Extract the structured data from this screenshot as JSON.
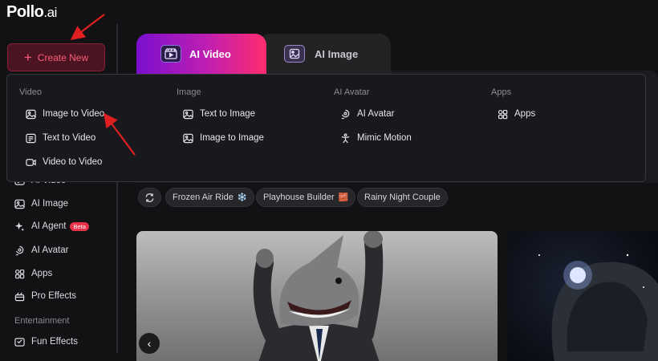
{
  "logo": {
    "brand": "Pollo",
    "suffix": ".ai"
  },
  "create_button": {
    "label": "Create New"
  },
  "sidebar": {
    "items": [
      {
        "label": "AI Video",
        "icon": "video-icon"
      },
      {
        "label": "AI Image",
        "icon": "image-icon"
      },
      {
        "label": "AI Agent",
        "icon": "sparkle-icon",
        "badge": "Beta"
      },
      {
        "label": "AI Avatar",
        "icon": "avatar-icon"
      },
      {
        "label": "Apps",
        "icon": "apps-icon"
      },
      {
        "label": "Pro Effects",
        "icon": "effects-icon"
      }
    ],
    "section_entertainment": "Entertainment",
    "entertainment_items": [
      {
        "label": "Fun Effects",
        "icon": "fun-effects-icon"
      }
    ]
  },
  "tabs": [
    {
      "label": "AI Video",
      "active": true
    },
    {
      "label": "AI Image",
      "active": false
    }
  ],
  "dropdown": {
    "columns": [
      {
        "heading": "Video",
        "items": [
          "Image to Video",
          "Text to Video",
          "Video to Video"
        ]
      },
      {
        "heading": "Image",
        "items": [
          "Text to Image",
          "Image to Image"
        ]
      },
      {
        "heading": "AI Avatar",
        "items": [
          "AI Avatar",
          "Mimic Motion"
        ]
      },
      {
        "heading": "Apps",
        "items": [
          "Apps"
        ]
      }
    ]
  },
  "chips": [
    {
      "label": "Frozen Air Ride",
      "emoji": "❄️"
    },
    {
      "label": "Playhouse Builder",
      "emoji": "🧱"
    },
    {
      "label": "Rainy Night Couple",
      "emoji": ""
    }
  ],
  "colors": {
    "accent": "#ff2d6f",
    "purple": "#7a0fcf",
    "create_bg": "#4a1422",
    "annotation_arrow": "#e02020"
  }
}
